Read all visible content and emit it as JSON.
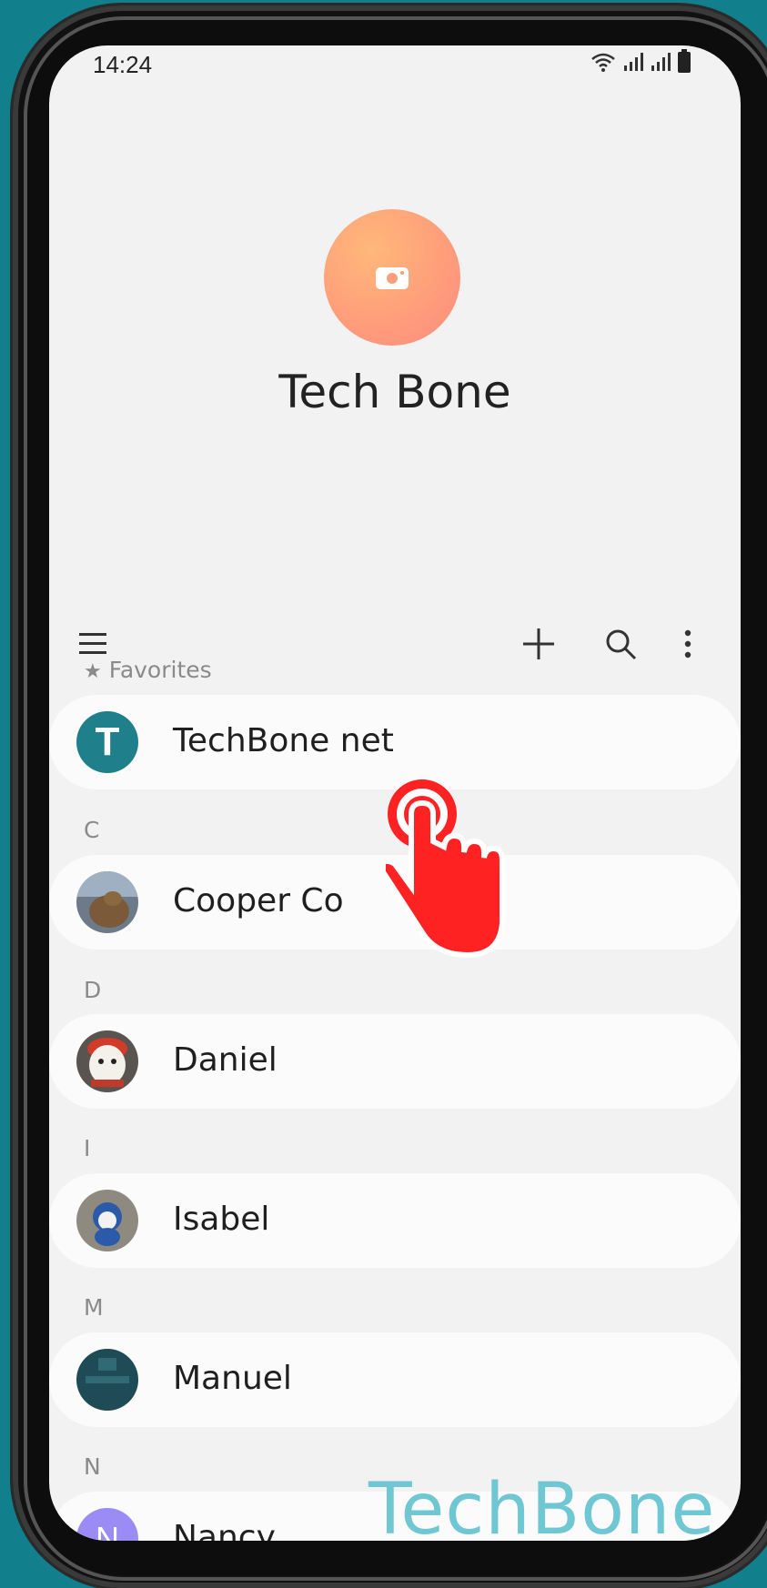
{
  "status_bar": {
    "time": "14:24"
  },
  "profile": {
    "name": "Tech Bone",
    "avatar_icon": "camera-icon"
  },
  "toolbar": {
    "menu_icon": "menu-icon",
    "add_icon": "plus-icon",
    "search_icon": "search-icon",
    "more_icon": "more-vert-icon"
  },
  "sections": {
    "favorites": "Favorites",
    "c": "C",
    "d": "D",
    "i": "I",
    "m": "M",
    "n": "N"
  },
  "contacts": {
    "techbone": {
      "name": "TechBone net",
      "initial": "T",
      "color": "#1f7f8a"
    },
    "cooper": {
      "name": "Cooper Co"
    },
    "daniel": {
      "name": "Daniel"
    },
    "isabel": {
      "name": "Isabel"
    },
    "manuel": {
      "name": "Manuel"
    },
    "nancy": {
      "name": "Nancy",
      "initial": "N",
      "color": "#9b8cf5"
    }
  },
  "watermark": "TechBone"
}
